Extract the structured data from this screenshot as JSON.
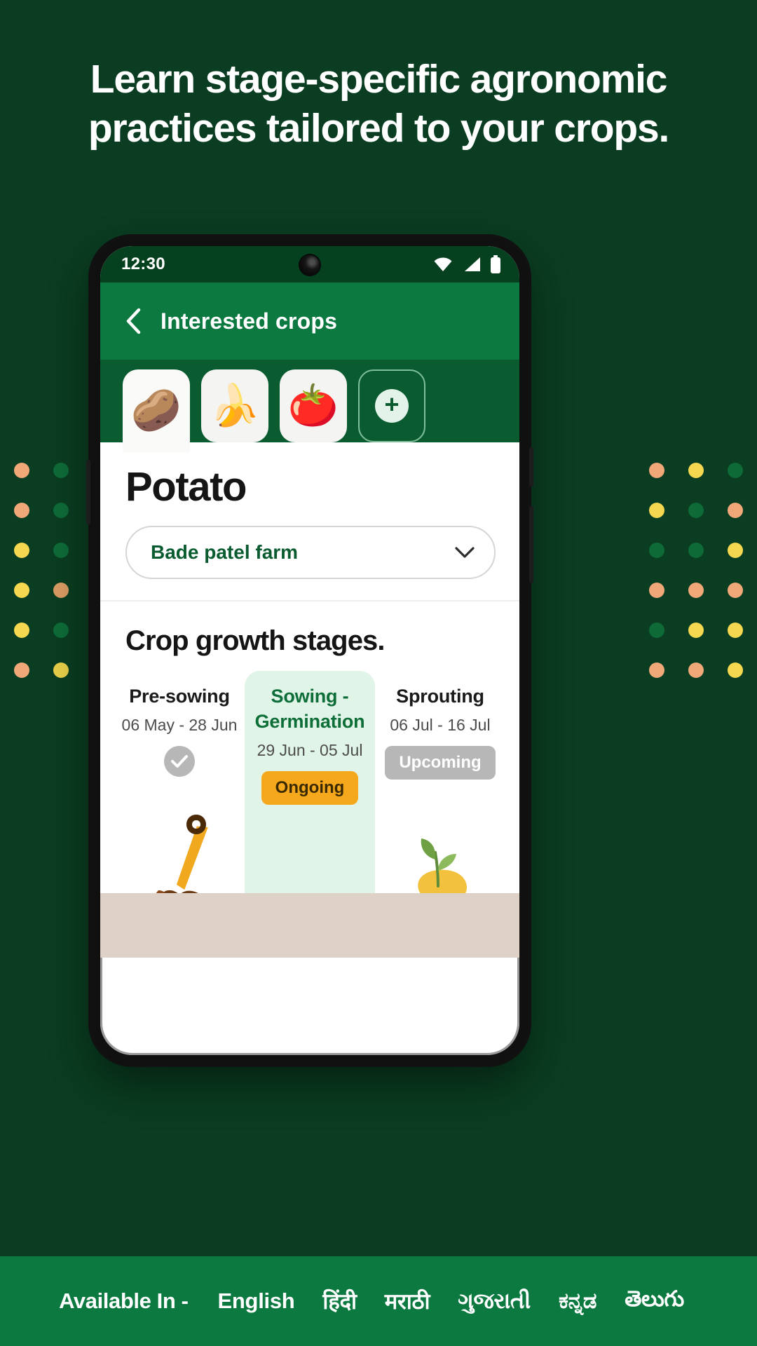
{
  "promo": {
    "headline": "Learn stage-specific agronomic practices tailored to your crops.",
    "background_color": "#0A3D21"
  },
  "phone": {
    "status_bar": {
      "time": "12:30",
      "icons": [
        "wifi-icon",
        "cellular-signal-icon",
        "battery-icon"
      ]
    },
    "app_bar": {
      "back_icon": "chevron-left-icon",
      "title": "Interested crops"
    },
    "crop_tabs": {
      "items": [
        {
          "name": "Potato",
          "emoji": "🥔",
          "active": true
        },
        {
          "name": "Banana",
          "emoji": "🍌",
          "active": false
        },
        {
          "name": "Tomato",
          "emoji": "🍅",
          "active": false
        }
      ],
      "add_label": "+",
      "add_icon": "plus-circle-icon"
    },
    "crop_detail": {
      "title": "Potato",
      "farm_selector": {
        "value": "Bade patel farm",
        "chevron_icon": "chevron-down-icon"
      },
      "stages_heading": "Crop growth stages.",
      "stages": [
        {
          "name": "Pre-sowing",
          "dates": "06 May - 28 Jun",
          "status": "completed",
          "status_icon": "check-circle-icon",
          "art": "shovel-soil-illustration"
        },
        {
          "name": "Sowing - Germination",
          "dates": "29 Jun - 05 Jul",
          "status": "Ongoing",
          "status_color": "#F5A81C",
          "art": "potato-tuber-illustration"
        },
        {
          "name": "Sprouting",
          "dates": "06 Jul - 16 Jul",
          "status": "Upcoming",
          "status_color": "#B7B7B7",
          "art": "sprouting-potato-illustration"
        }
      ]
    }
  },
  "footer": {
    "label": "Available In -",
    "languages": [
      "English",
      "हिंदी",
      "मराठी",
      "ગુજરાતી",
      "ಕನ್ನಡ",
      "తెలుగు"
    ],
    "background_color": "#0C7A40"
  },
  "decor": {
    "dot_colors_left": [
      "#F0A878",
      "#0E6B38",
      "#0E6B38",
      "#F0A878",
      "#0E6B38",
      "#D9B83A",
      "#F5D84F",
      "#0E6B38",
      "#0E6B38",
      "#F5D84F",
      "#D99B63",
      "#0E6B38",
      "#F5D84F",
      "#0E6B38",
      "#C98A4B",
      "#F0A878",
      "#E8CE4A",
      "#0E6B38"
    ],
    "dot_colors_right": [
      "#F0A878",
      "#F5D84F",
      "#0E6B38",
      "#F5D84F",
      "#0E6B38",
      "#F0A878",
      "#0E6B38",
      "#0E6B38",
      "#F5D84F",
      "#F0A878",
      "#F0A878",
      "#F0A878",
      "#0E6B38",
      "#F5D84F",
      "#F5D84F",
      "#F0A878",
      "#F0A878",
      "#F5D84F"
    ]
  }
}
